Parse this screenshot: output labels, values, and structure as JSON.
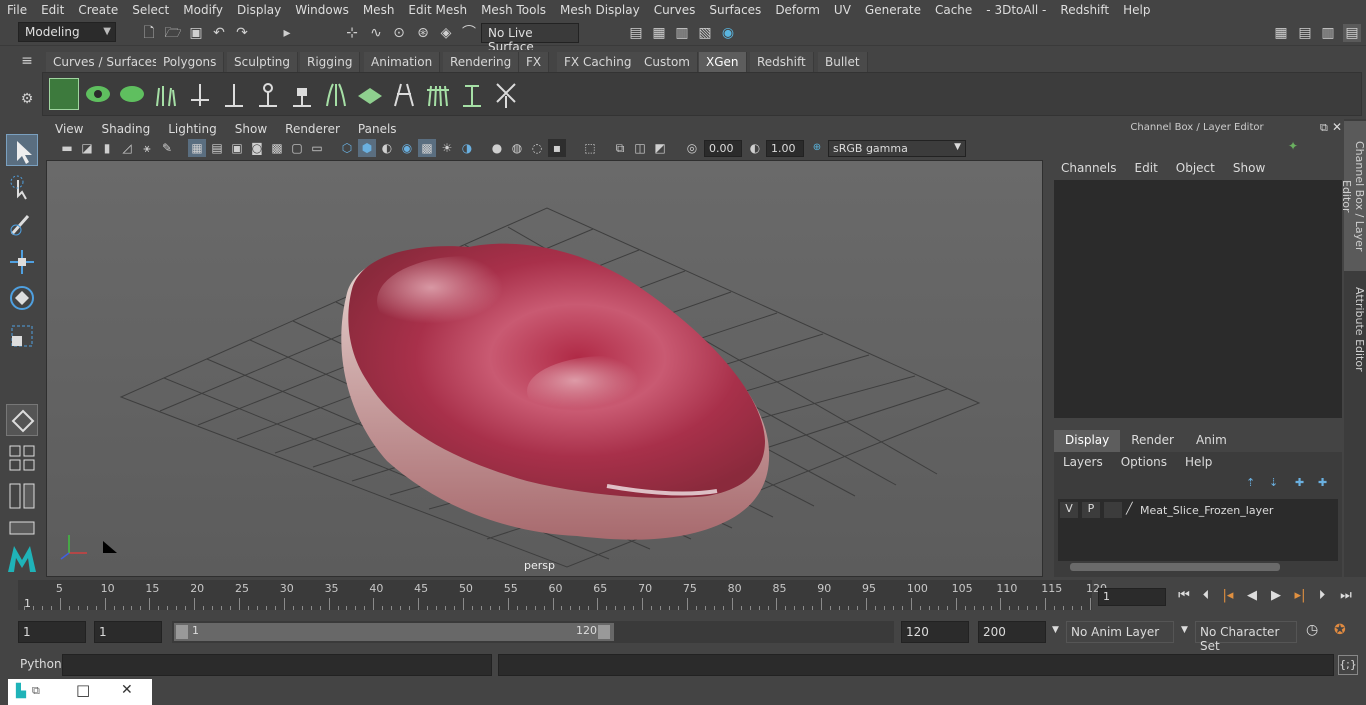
{
  "menubar": [
    "File",
    "Edit",
    "Create",
    "Select",
    "Modify",
    "Display",
    "Windows",
    "Mesh",
    "Edit Mesh",
    "Mesh Tools",
    "Mesh Display",
    "Curves",
    "Surfaces",
    "Deform",
    "UV",
    "Generate",
    "Cache",
    "- 3DtoAll -",
    "Redshift",
    "Help"
  ],
  "status": {
    "mode": "Modeling",
    "live_surface": "No Live Surface"
  },
  "shelf_tabs": [
    "Curves / Surfaces",
    "Polygons",
    "Sculpting",
    "Rigging",
    "Animation",
    "Rendering",
    "FX",
    "FX Caching",
    "Custom",
    "XGen",
    "Redshift",
    "Bullet"
  ],
  "shelf_active": "XGen",
  "viewport_menu": [
    "View",
    "Shading",
    "Lighting",
    "Show",
    "Renderer",
    "Panels"
  ],
  "viewport_fields": {
    "exposure": "0.00",
    "gamma": "1.00",
    "colorspace": "sRGB gamma"
  },
  "viewport_label": "persp",
  "channel_box": {
    "title": "Channel Box / Layer Editor",
    "menu": [
      "Channels",
      "Edit",
      "Object",
      "Show"
    ]
  },
  "layer_editor": {
    "tabs": [
      "Display",
      "Render",
      "Anim"
    ],
    "active_tab": "Display",
    "menu": [
      "Layers",
      "Options",
      "Help"
    ],
    "layer": {
      "v": "V",
      "p": "P",
      "name": "Meat_Slice_Frozen_layer"
    }
  },
  "side_tabs": [
    "Channel Box / Layer Editor",
    "Attribute Editor"
  ],
  "timeline": {
    "ticks": [
      "5",
      "10",
      "15",
      "20",
      "25",
      "30",
      "35",
      "40",
      "45",
      "50",
      "55",
      "60",
      "65",
      "70",
      "75",
      "80",
      "85",
      "90",
      "95",
      "100",
      "105",
      "110",
      "115",
      "120"
    ],
    "start_label": "1",
    "current_frame": "1"
  },
  "range": {
    "start": "1",
    "playback_start": "1",
    "slider_start": "1",
    "slider_end": "120",
    "end": "120",
    "anim_end": "200",
    "anim_layer": "No Anim Layer",
    "char_set": "No Character Set"
  },
  "cmdline": {
    "label": "Python"
  }
}
